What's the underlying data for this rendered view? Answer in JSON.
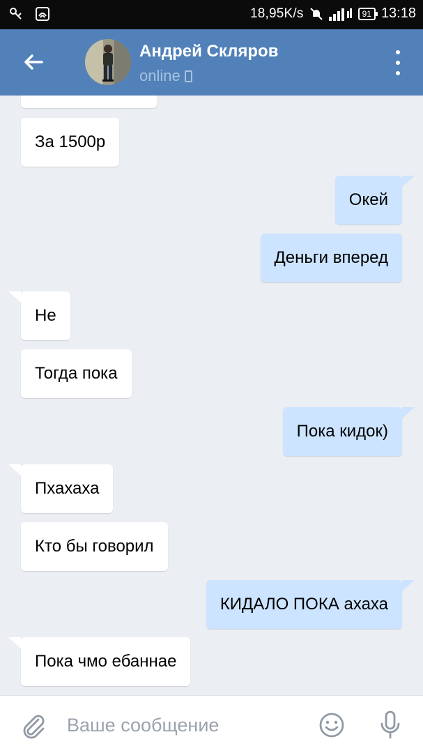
{
  "status_bar": {
    "network_speed": "18,95K/s",
    "battery_level": "91",
    "time": "13:18"
  },
  "header": {
    "contact_name": "Андрей Скляров",
    "presence": "online",
    "background_color": "#5181b8"
  },
  "messages": [
    {
      "direction": "incoming",
      "text": "За 1500р"
    },
    {
      "direction": "outgoing",
      "text": "Окей"
    },
    {
      "direction": "outgoing",
      "text": "Деньги вперед"
    },
    {
      "direction": "incoming",
      "text": "Не"
    },
    {
      "direction": "incoming",
      "text": "Тогда пока"
    },
    {
      "direction": "outgoing",
      "text": "Пока кидок)"
    },
    {
      "direction": "incoming",
      "text": "Пхахаха"
    },
    {
      "direction": "incoming",
      "text": "Кто бы говорил"
    },
    {
      "direction": "outgoing",
      "text": "КИДАЛО ПОКА ахаха"
    },
    {
      "direction": "incoming",
      "text": "Пока чмо ебаннае"
    }
  ],
  "composer": {
    "placeholder": "Ваше сообщение",
    "value": ""
  },
  "colors": {
    "incoming_bubble": "#ffffff",
    "outgoing_bubble": "#cce4ff",
    "chat_background": "#ebeef2"
  },
  "icons": {
    "back": "arrow-left-icon",
    "more": "more-vertical-icon",
    "attach": "paperclip-icon",
    "emoji": "smiley-icon",
    "mic": "microphone-icon"
  }
}
